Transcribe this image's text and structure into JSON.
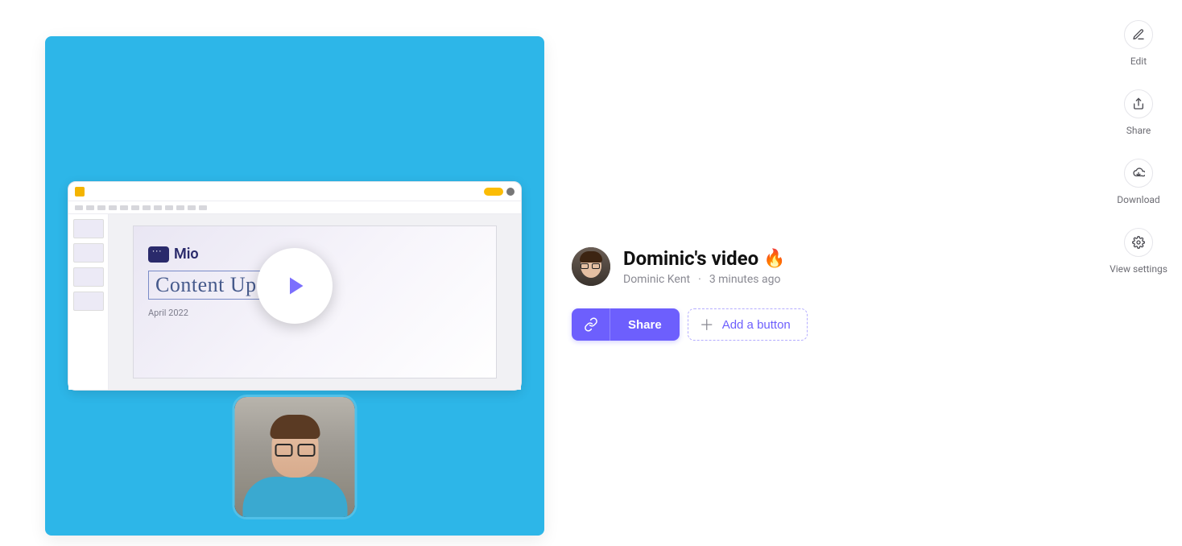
{
  "rail": {
    "edit": "Edit",
    "share": "Share",
    "download": "Download",
    "view_settings": "View settings"
  },
  "preview": {
    "slide_title": "Content Update",
    "slide_date": "April 2022",
    "brand_word": "Mio"
  },
  "video": {
    "title": "Dominic's video",
    "emoji": "🔥",
    "author": "Dominic Kent",
    "timestamp": "3 minutes ago"
  },
  "actions": {
    "share": "Share",
    "add_button": "Add a button"
  }
}
